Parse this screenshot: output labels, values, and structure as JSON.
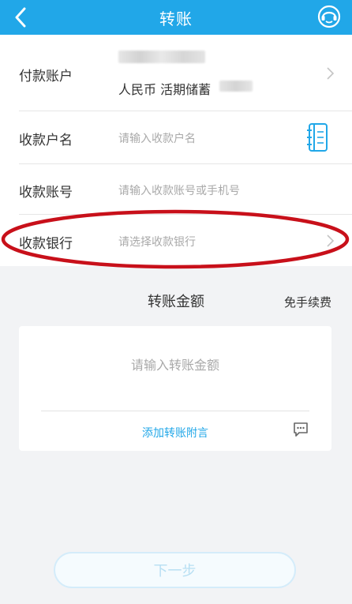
{
  "header": {
    "title": "转账",
    "back_icon": "back-chevron-icon",
    "service_icon": "customer-service-icon"
  },
  "form": {
    "payment_account": {
      "label": "付款账户",
      "account_type": "人民币 活期储蓄"
    },
    "payee_name": {
      "label": "收款户名",
      "placeholder": "请输入收款户名"
    },
    "payee_account": {
      "label": "收款账号",
      "placeholder": "请输入收款账号或手机号"
    },
    "payee_bank": {
      "label": "收款银行",
      "placeholder": "请选择收款银行"
    }
  },
  "amount": {
    "title": "转账金额",
    "fee": "免手续费",
    "placeholder": "请输入转账金额",
    "memo_link": "添加转账附言"
  },
  "footer": {
    "next_label": "下一步"
  },
  "colors": {
    "accent": "#21a7e8",
    "annotation": "#c8101a"
  }
}
